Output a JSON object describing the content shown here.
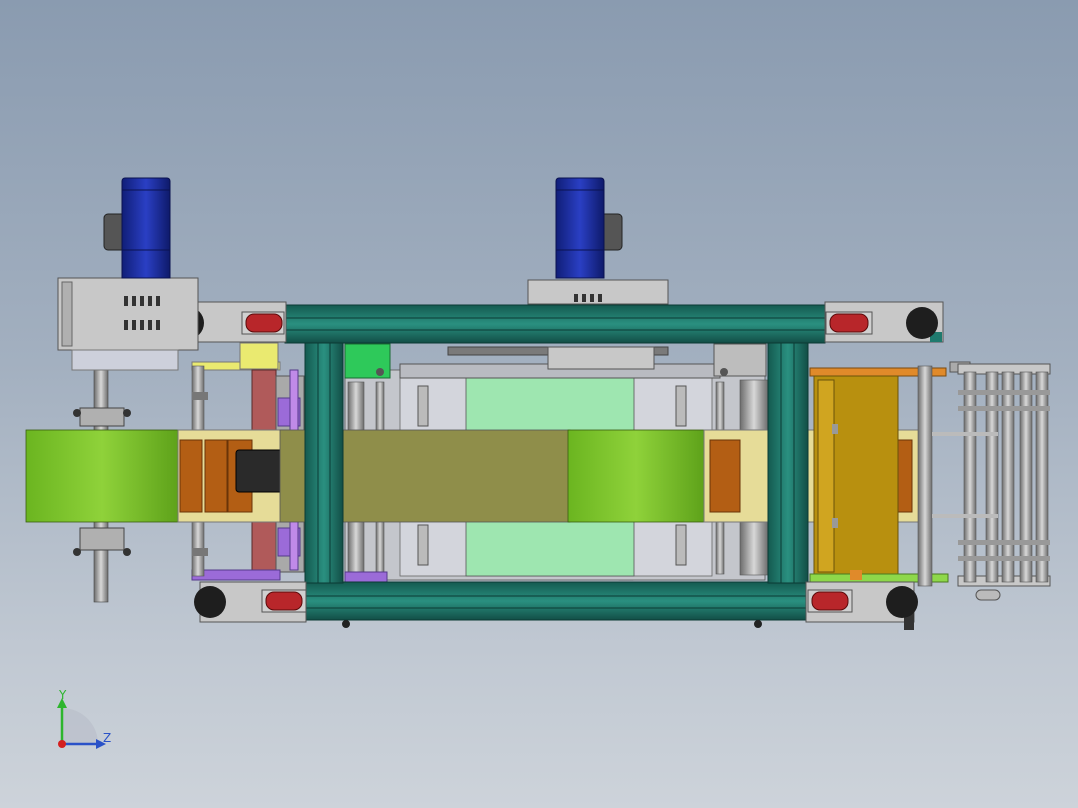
{
  "viewport": {
    "background_top": "#8a9bb0",
    "background_bottom": "#cdd3da"
  },
  "model": {
    "frame_color": "#1f7a6e",
    "motor_color": "#1d2fa8",
    "belt_color": "#7cc22a",
    "wheel_color": "#b8262a",
    "plate_color": "#c8c8c8",
    "product_color": "#b35e14",
    "bracket_color": "#b8900f",
    "highlight_green": "#9ee6b0",
    "highlight_purple": "#9b6bd8",
    "highlight_yellow": "#eaea70"
  },
  "triad": {
    "y_label": "Y",
    "z_label": "Z",
    "y_color": "#2db52d",
    "z_color": "#2a52c8",
    "x_color": "#d42020"
  }
}
